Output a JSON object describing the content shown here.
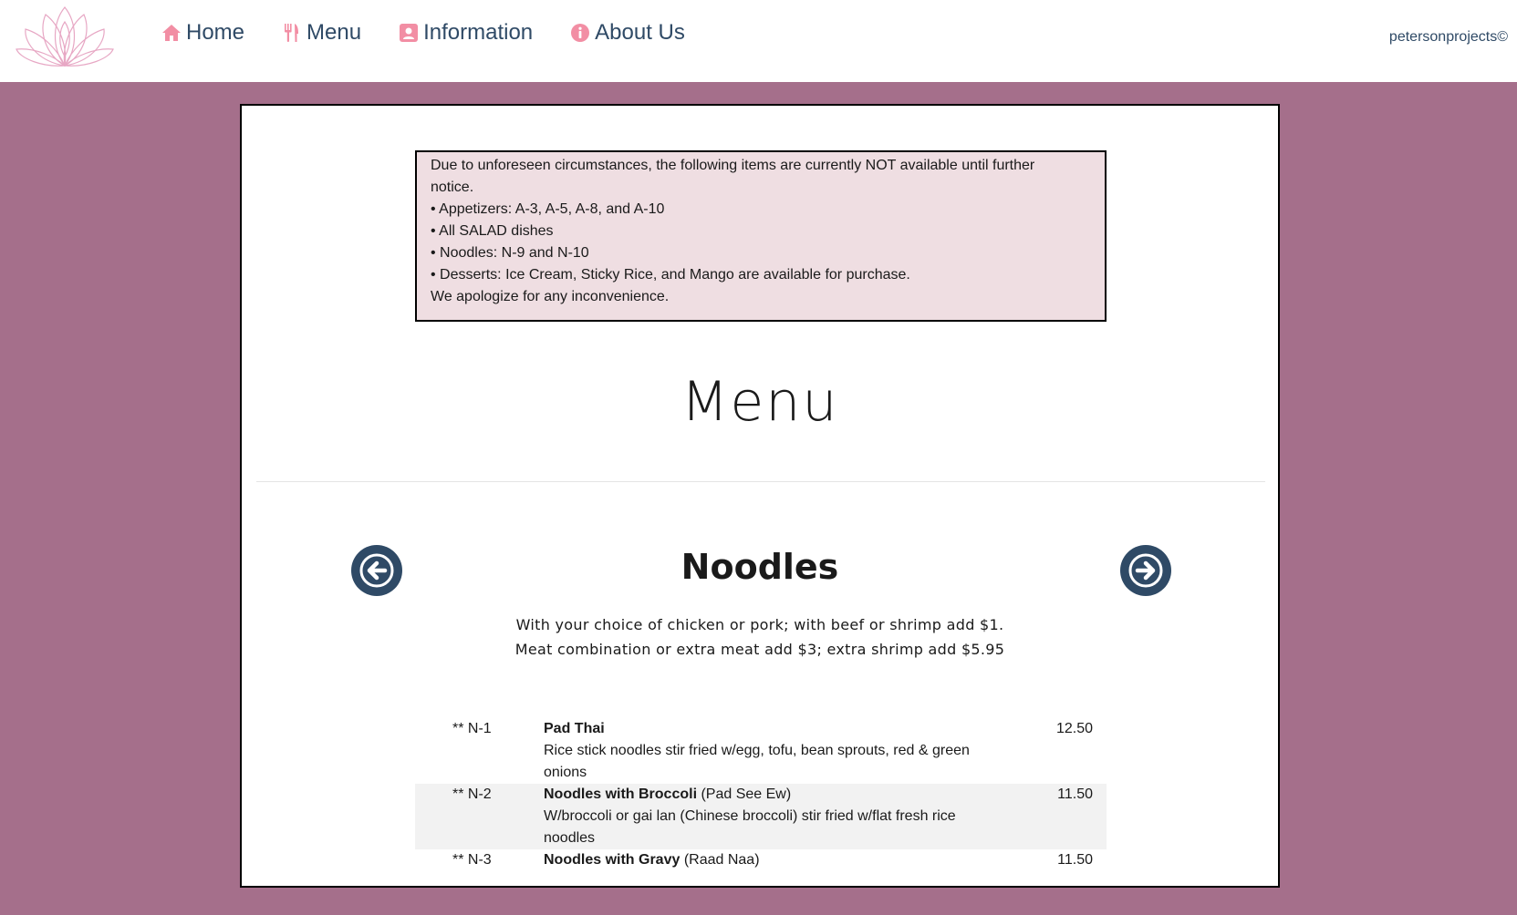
{
  "nav": {
    "items": [
      {
        "label": "Home",
        "icon": "home-icon"
      },
      {
        "label": "Menu",
        "icon": "fork-knife-icon"
      },
      {
        "label": "Information",
        "icon": "contact-card-icon"
      },
      {
        "label": "About Us",
        "icon": "info-icon"
      }
    ],
    "brand": "petersonprojects©"
  },
  "colors": {
    "accent_pink": "#f28ea4",
    "navy": "#2f4a66",
    "background": "#a56f8b",
    "notice_bg": "#efdee2"
  },
  "notice": {
    "lines": [
      "Due to unforeseen circumstances, the following items are currently NOT available until further",
      "notice.",
      "• Appetizers: A-3, A-5, A-8, and A-10",
      "• All SALAD dishes",
      "• Noodles: N-9 and N-10",
      "• Desserts: Ice Cream, Sticky Rice, and Mango are available for purchase.",
      "We apologize for any inconvenience."
    ]
  },
  "menu": {
    "title": "Menu",
    "section": {
      "title": "Noodles",
      "desc": [
        "With your choice of chicken or pork; with beef or shrimp add $1.",
        "Meat combination or extra meat add $3; extra shrimp add $5.95"
      ],
      "items": [
        {
          "code": "** N-1",
          "name": "Pad Thai",
          "alt": "",
          "desc": "Rice stick noodles stir fried w/egg, tofu, bean sprouts, red & green onions",
          "price": "12.50"
        },
        {
          "code": "** N-2",
          "name": "Noodles with Broccoli",
          "alt": "(Pad See Ew)",
          "desc": "W/broccoli or gai lan (Chinese broccoli) stir fried w/flat fresh rice noodles",
          "price": "11.50"
        },
        {
          "code": "** N-3",
          "name": "Noodles with Gravy",
          "alt": "(Raad Naa)",
          "desc": "",
          "price": "11.50"
        }
      ]
    }
  }
}
